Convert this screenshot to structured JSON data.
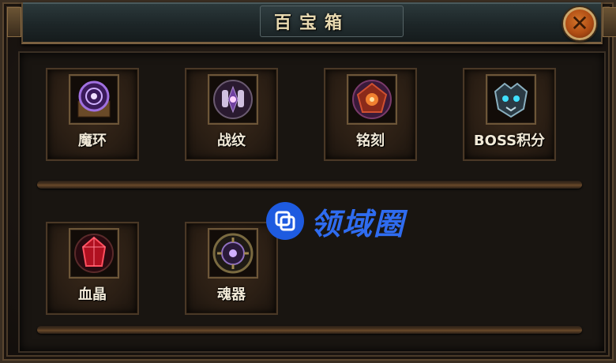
{
  "window": {
    "title": "百宝箱",
    "close_icon": "close-icon"
  },
  "items": [
    {
      "label": "魔环",
      "icon": "magic-ring-icon",
      "color": "#a070e0"
    },
    {
      "label": "战纹",
      "icon": "battle-pattern-icon",
      "color": "#b090d0"
    },
    {
      "label": "铭刻",
      "icon": "inscription-icon",
      "color": "#d05030"
    },
    {
      "label": "BOSS积分",
      "icon": "boss-points-icon",
      "color": "#8ab0c0"
    },
    {
      "label": "血晶",
      "icon": "blood-crystal-icon",
      "color": "#d02030"
    },
    {
      "label": "魂器",
      "icon": "soul-vessel-icon",
      "color": "#9070c0"
    }
  ],
  "watermark": {
    "text": "领域圈",
    "color": "#2f6cf0"
  }
}
